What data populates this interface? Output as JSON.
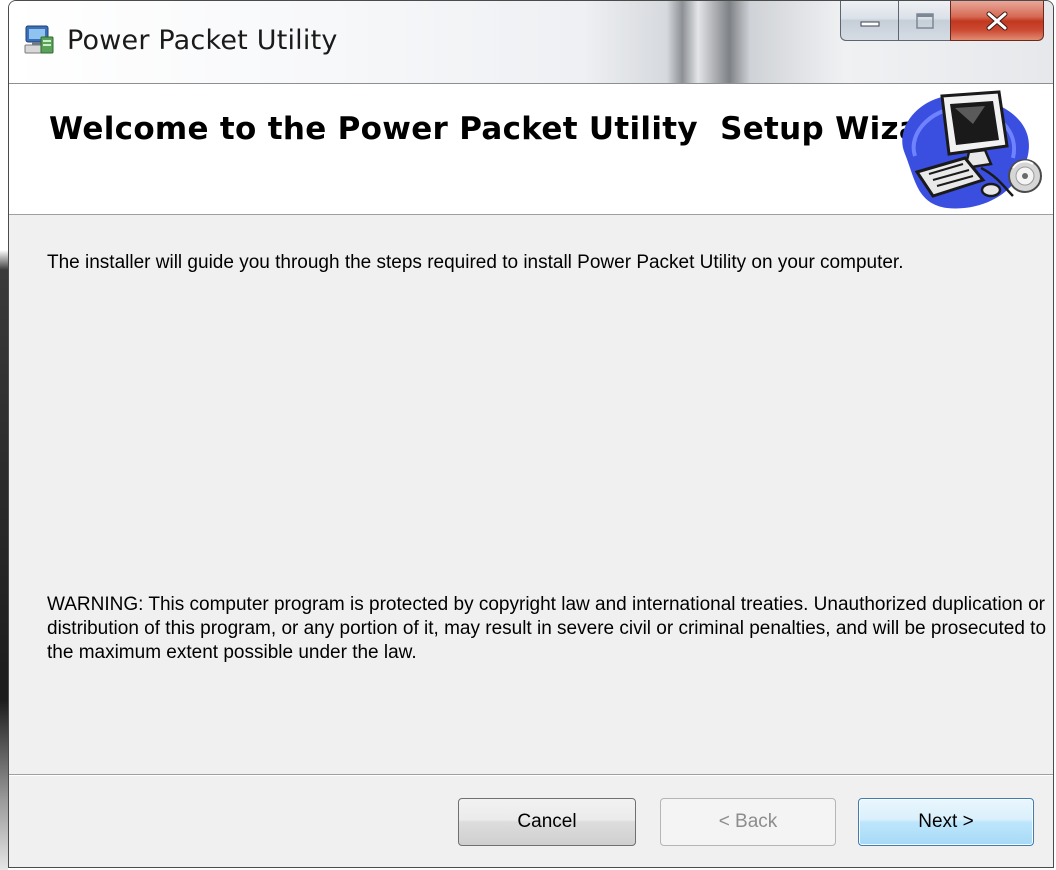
{
  "window": {
    "title": "Power Packet Utility"
  },
  "header": {
    "title": "Welcome to the Power Packet Utility  Setup Wizard"
  },
  "body": {
    "intro": "The installer will guide you through the steps required to install Power Packet Utility  on your computer.",
    "warning": "WARNING: This computer program is protected by copyright law and international treaties. Unauthorized duplication or distribution of this program, or any portion of it, may result in severe civil or criminal penalties, and will be prosecuted to the maximum extent possible under the law."
  },
  "buttons": {
    "cancel": "Cancel",
    "back": "< Back",
    "next": "Next >"
  },
  "icons": {
    "app": "installer-icon",
    "minimize": "minimize-icon",
    "maximize": "maximize-icon",
    "close": "close-icon",
    "banner": "computer-setup-icon"
  },
  "colors": {
    "close_button": "#c2381f",
    "default_button_border": "#3c7fb1",
    "dialog_background": "#f0f0f0"
  }
}
